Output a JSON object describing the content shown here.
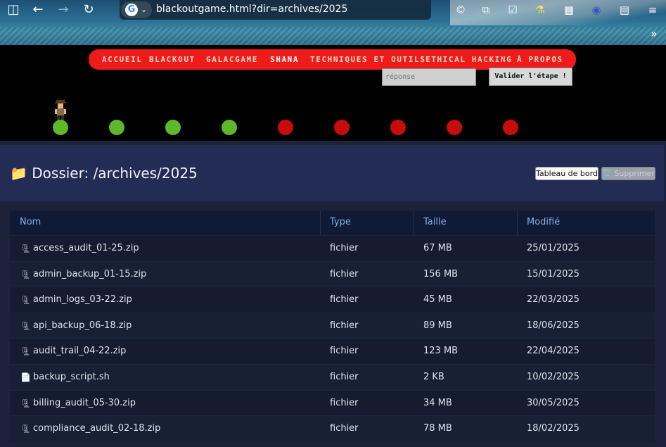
{
  "browser": {
    "url": "blackoutgame.html?dir=archives/2025"
  },
  "nav": {
    "items": [
      "ACCUEIL",
      "BLACKOUT",
      "GALACGAME",
      "SHANA",
      "TECHNIQUES ET OUTILS",
      "ETHICAL HACKING",
      "À PROPOS"
    ],
    "active": "SHANA"
  },
  "game": {
    "answer_placeholder": "réponse",
    "validate_label": "Valider l'étape !",
    "steps": [
      "completed",
      "completed",
      "completed",
      "completed",
      "pending",
      "pending",
      "pending",
      "pending",
      "pending"
    ],
    "colors": {
      "completed": "#5eb92a",
      "pending": "#c80c0c",
      "nav": "#ef1b1b"
    }
  },
  "explorer": {
    "title": "📁 Dossier: /archives/2025",
    "dashboard_label": "Tableau de bord",
    "delete_label": "🗑️ Supprimer",
    "columns": [
      "Nom",
      "Type",
      "Taille",
      "Modifié"
    ],
    "files": [
      {
        "icon": "🗜",
        "name": "access_audit_01-25.zip",
        "type": "fichier",
        "size": "67 MB",
        "modified": "25/01/2025"
      },
      {
        "icon": "🗜",
        "name": "admin_backup_01-15.zip",
        "type": "fichier",
        "size": "156 MB",
        "modified": "15/01/2025"
      },
      {
        "icon": "🗜",
        "name": "admin_logs_03-22.zip",
        "type": "fichier",
        "size": "45 MB",
        "modified": "22/03/2025"
      },
      {
        "icon": "🗜",
        "name": "api_backup_06-18.zip",
        "type": "fichier",
        "size": "89 MB",
        "modified": "18/06/2025"
      },
      {
        "icon": "🗜",
        "name": "audit_trail_04-22.zip",
        "type": "fichier",
        "size": "123 MB",
        "modified": "22/04/2025"
      },
      {
        "icon": "📄",
        "name": "backup_script.sh",
        "type": "fichier",
        "size": "2 KB",
        "modified": "10/02/2025"
      },
      {
        "icon": "🗜",
        "name": "billing_audit_05-30.zip",
        "type": "fichier",
        "size": "34 MB",
        "modified": "30/05/2025"
      },
      {
        "icon": "🗜",
        "name": "compliance_audit_02-18.zip",
        "type": "fichier",
        "size": "78 MB",
        "modified": "18/02/2025"
      }
    ]
  }
}
